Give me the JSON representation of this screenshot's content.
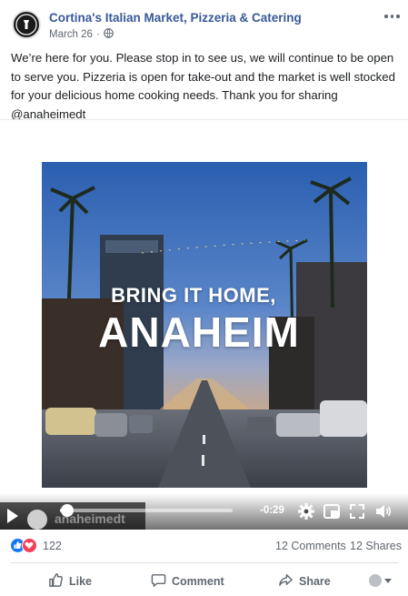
{
  "post": {
    "page_name": "Cortina's Italian Market, Pizzeria & Catering",
    "date": "March 26",
    "separator": "·",
    "audience_icon": "globe-icon",
    "text": "We’re here for you. Please stop in to see us, we will continue to be open to serve you. Pizzeria is open for take-out and the market is well stocked for your delicious home cooking needs. Thank you for sharing @anaheimedt"
  },
  "video": {
    "overlay_line1": "BRING IT HOME,",
    "overlay_line2": "ANAHEIM",
    "watermark": "anaheimedt",
    "time_remaining": "-0:29",
    "progress": 0.04
  },
  "engagement": {
    "reaction_count": "122",
    "comments": "12 Comments",
    "shares": "12 Shares"
  },
  "actions": {
    "like": "Like",
    "comment": "Comment",
    "share": "Share"
  },
  "colors": {
    "page_name": "#385898",
    "like_blue": "#1877f2",
    "love_red": "#f33e58",
    "secondary_text": "#606770"
  }
}
